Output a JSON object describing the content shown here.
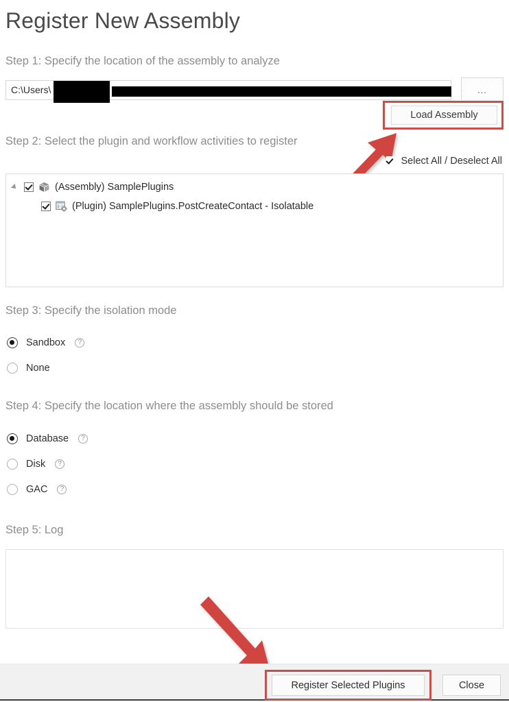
{
  "dialog": {
    "title": "Register New Assembly"
  },
  "step1": {
    "label": "Step 1: Specify the location of the assembly to analyze",
    "path_value": "C:\\Users\\",
    "path_placeholder": "",
    "browse_label": "...",
    "load_label": "Load Assembly"
  },
  "step2": {
    "label": "Step 2: Select the plugin and workflow activities to register",
    "select_all_label": "Select All / Deselect All",
    "select_all_checked": true,
    "tree": [
      {
        "label": "(Assembly) SamplePlugins",
        "icon": "assembly-box-icon",
        "checked": true,
        "level": 0,
        "expanded": true
      },
      {
        "label": "(Plugin) SamplePlugins.PostCreateContact - Isolatable",
        "icon": "plugin-gear-icon",
        "checked": true,
        "level": 1,
        "expanded": false
      }
    ]
  },
  "step3": {
    "label": "Step 3: Specify the isolation mode",
    "options": [
      {
        "label": "Sandbox",
        "selected": true,
        "help": true
      },
      {
        "label": "None",
        "selected": false,
        "help": false
      }
    ]
  },
  "step4": {
    "label": "Step 4: Specify the location where the assembly should be stored",
    "options": [
      {
        "label": "Database",
        "selected": true,
        "help": true
      },
      {
        "label": "Disk",
        "selected": false,
        "help": true
      },
      {
        "label": "GAC",
        "selected": false,
        "help": true
      }
    ]
  },
  "step5": {
    "label": "Step 5: Log",
    "log_text": ""
  },
  "footer": {
    "register_label": "Register Selected Plugins",
    "close_label": "Close"
  },
  "annotations": {
    "highlight_color": "#c4504c",
    "arrow_color": "#d0453f",
    "help_glyph": "?"
  }
}
